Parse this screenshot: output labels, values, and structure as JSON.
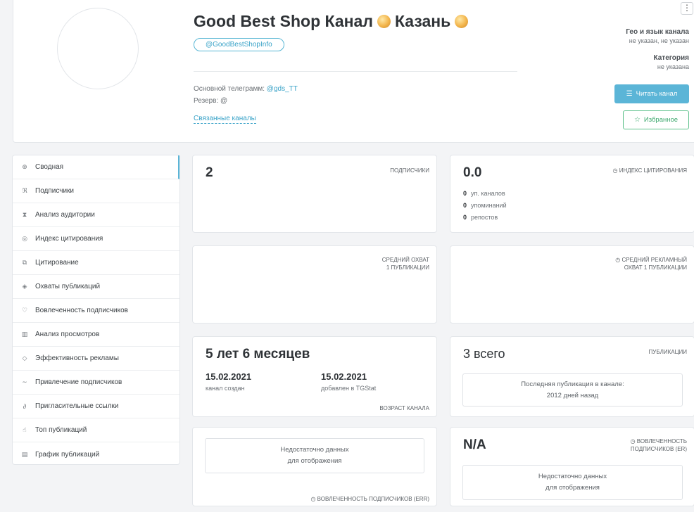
{
  "header": {
    "title_part1": "Good Best Shop Канал",
    "title_part2": "Казань",
    "handle": "@GoodBestShopInfo",
    "main_telegram_label": "Основной телеграмм:",
    "main_telegram_value": "@gds_TT",
    "reserve_label": "Резерв:",
    "reserve_value": "@",
    "related_channels": "Связанные каналы",
    "menu_icon": "⋮",
    "geo_label": "Гео и язык канала",
    "geo_value": "не указан, не указан",
    "category_label": "Категория",
    "category_value": "не указана",
    "read_button": "Читать канал",
    "favorite_button": "Избранное"
  },
  "sidebar": {
    "items": [
      {
        "icon": "⊕",
        "label": "Сводная"
      },
      {
        "icon": "ℜ",
        "label": "Подписчики"
      },
      {
        "icon": "⧗",
        "label": "Анализ аудитории"
      },
      {
        "icon": "◎",
        "label": "Индекс цитирования"
      },
      {
        "icon": "⧉",
        "label": "Цитирование"
      },
      {
        "icon": "◈",
        "label": "Охваты публикаций"
      },
      {
        "icon": "♡",
        "label": "Вовлеченность подписчиков"
      },
      {
        "icon": "▥",
        "label": "Анализ просмотров"
      },
      {
        "icon": "◇",
        "label": "Эффективность рекламы"
      },
      {
        "icon": "∼",
        "label": "Привлечение подписчиков"
      },
      {
        "icon": "∂",
        "label": "Пригласительные ссылки"
      },
      {
        "icon": "☝",
        "label": "Топ публикаций"
      },
      {
        "icon": "▤",
        "label": "График публикаций"
      }
    ]
  },
  "cards": {
    "subscribers": {
      "value": "2",
      "label": "ПОДПИСЧИКИ"
    },
    "citation": {
      "value": "0.0",
      "label": "ИНДЕКС ЦИТИРОВАНИЯ",
      "rows": [
        {
          "num": "0",
          "text": "уп. каналов"
        },
        {
          "num": "0",
          "text": "упоминаний"
        },
        {
          "num": "0",
          "text": "репостов"
        }
      ]
    },
    "avg_reach": {
      "label_1": "СРЕДНИЙ ОХВАТ",
      "label_2": "1 ПУБЛИКАЦИИ"
    },
    "avg_ad_reach": {
      "label_1": "СРЕДНИЙ РЕКЛАМНЫЙ",
      "label_2": "ОХВАТ 1 ПУБЛИКАЦИИ"
    },
    "age": {
      "value": "5 лет 6 месяцев",
      "created_date": "15.02.2021",
      "created_label": "канал создан",
      "added_date": "15.02.2021",
      "added_label": "добавлен в TGStat",
      "label": "ВОЗРАСТ КАНАЛА"
    },
    "publications": {
      "value": "3 всего",
      "label": "ПУБЛИКАЦИИ",
      "last_line_1": "Последняя публикация в канале:",
      "last_line_2": "2012 дней назад"
    },
    "err": {
      "nodata_1": "Недостаточно данных",
      "nodata_2": "для отображения",
      "label": "ВОВЛЕЧЕННОСТЬ ПОДПИСЧИКОВ (ERR)"
    },
    "er": {
      "value": "N/A",
      "label_1": "ВОВЛЕЧЕННОСТЬ",
      "label_2": "ПОДПИСЧИКОВ (ER)",
      "nodata_1": "Недостаточно данных",
      "nodata_2": "для отображения"
    }
  }
}
